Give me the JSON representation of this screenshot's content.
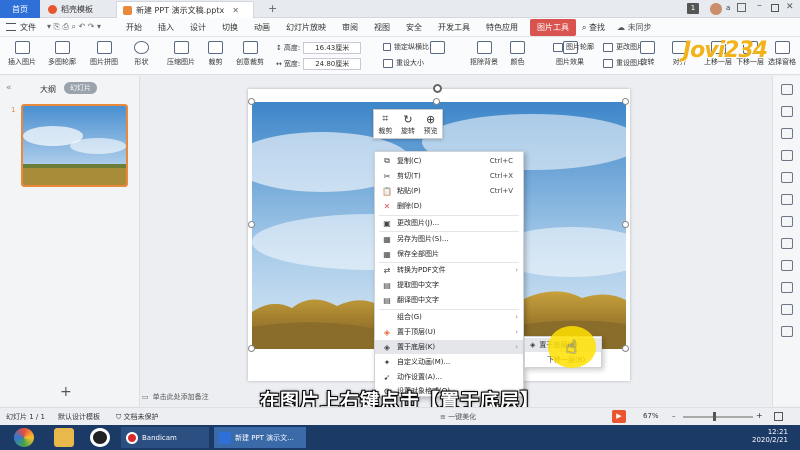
{
  "titlebar": {
    "home_tab": "首页",
    "template_tab": "稻壳模板",
    "doc_tab": "新建 PPT 演示文稿.pptx",
    "badge": "1",
    "user": "a"
  },
  "menubar": {
    "file": "文件",
    "items": [
      "开始",
      "插入",
      "设计",
      "切换",
      "动画",
      "幻灯片放映",
      "审阅",
      "视图",
      "安全",
      "开发工具",
      "特色应用"
    ],
    "picture_tools": "图片工具",
    "search": "查找",
    "right": "未同步"
  },
  "ribbon": {
    "insert_picture": "插入图片",
    "multi_outline": "多图轮廓",
    "picture_collage": "图片拼图",
    "shape": "形状",
    "compress": "压缩图片",
    "crop": "裁剪",
    "creative_crop": "创意裁剪",
    "height_label": "高度:",
    "height_value": "16.43厘米",
    "width_label": "宽度:",
    "width_value": "24.80厘米",
    "lock_ratio": "锁定纵横比",
    "reset_size": "重设大小",
    "remove_bg": "抠除背景",
    "color": "颜色",
    "picture_effect": "图片效果",
    "picture_outline": "图片轮廓",
    "change_picture": "更改图片",
    "reset_picture": "重设图片",
    "rotate": "旋转",
    "align": "对齐",
    "bring_forward": "上移一层",
    "send_backward": "下移一层",
    "select_pane": "选择窗格"
  },
  "leftpanel": {
    "outline_tab": "大纲",
    "slides_tab": "幻灯片",
    "slide_number": "1",
    "add": "+"
  },
  "floatbar": {
    "crop": "裁剪",
    "rotate": "旋转",
    "preview": "预览"
  },
  "context_menu": {
    "copy": "复制(C)",
    "copy_sc": "Ctrl+C",
    "cut": "剪切(T)",
    "cut_sc": "Ctrl+X",
    "paste": "粘贴(P)",
    "paste_sc": "Ctrl+V",
    "delete": "删除(D)",
    "change_picture": "更改图片(J)...",
    "save_as_picture": "另存为图片(S)...",
    "save_all": "保存全部图片",
    "to_pdf": "转换为PDF文件",
    "extract_text": "提取图中文字",
    "translate_text": "翻译图中文字",
    "group": "组合(G)",
    "bring_to_top": "置于顶层(U)",
    "send_to_bottom": "置于底层(K)",
    "custom_animation": "自定义动画(M)...",
    "action_settings": "动作设置(A)...",
    "format_object": "设置对象格式(O)..."
  },
  "submenu": {
    "send_to_back": "置于底层(K)",
    "send_backward": "下移一层(B)"
  },
  "notes_placeholder": "单击此处添加备注",
  "statusbar": {
    "slide_info": "幻灯片 1 / 1",
    "theme": "默认设计模板",
    "protect": "文档未保护",
    "beautify": "一键美化",
    "zoom": "67%"
  },
  "taskbar": {
    "bandicam": "Bandicam",
    "wps": "新建 PPT 演示文...",
    "time": "12:21",
    "date": "2020/2/21"
  },
  "caption": "在图片上右键点击【置于底层】",
  "watermark": "Jovi234",
  "colors": {
    "accent": "#2f6fd8",
    "picture_tools": "#d9534f",
    "highlight": "#ffe100",
    "taskbar": "#1b3a66"
  }
}
